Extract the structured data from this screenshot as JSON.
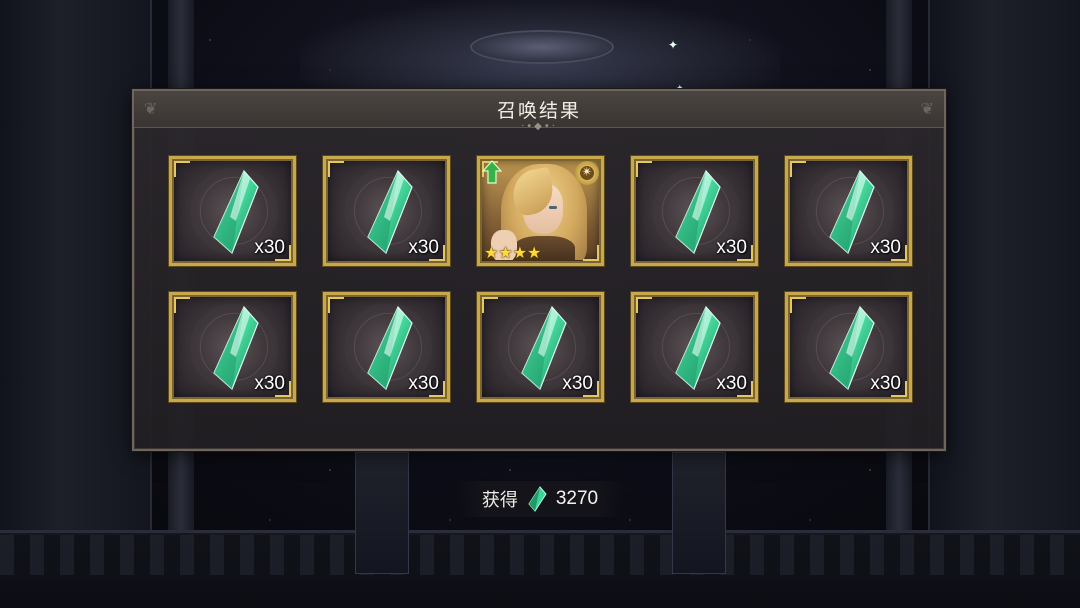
{
  "dialog": {
    "title": "召唤结果"
  },
  "results": [
    {
      "type": "crystal",
      "quantity": "x30"
    },
    {
      "type": "crystal",
      "quantity": "x30"
    },
    {
      "type": "hero",
      "rarity_stars": 4,
      "upgrade": true
    },
    {
      "type": "crystal",
      "quantity": "x30"
    },
    {
      "type": "crystal",
      "quantity": "x30"
    },
    {
      "type": "crystal",
      "quantity": "x30"
    },
    {
      "type": "crystal",
      "quantity": "x30"
    },
    {
      "type": "crystal",
      "quantity": "x30"
    },
    {
      "type": "crystal",
      "quantity": "x30"
    },
    {
      "type": "crystal",
      "quantity": "x30"
    }
  ],
  "footer": {
    "label": "获得",
    "icon": "green-crystal-icon",
    "total": "3270"
  },
  "colors": {
    "frame_gold": "#c7a84c",
    "crystal_green": "#3fd39a",
    "star_yellow": "#ffd93a",
    "upgrade_green": "#37b24a"
  }
}
